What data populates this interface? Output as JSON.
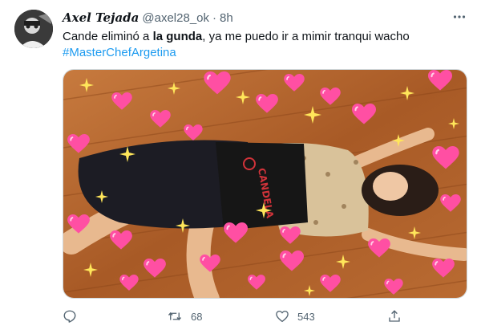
{
  "tweet": {
    "author": {
      "display_name": "Axel Tejada",
      "handle": "@axel28_ok",
      "separator": "·",
      "time": "8h"
    },
    "text_pre": "Cande eliminó a ",
    "text_bold": "la gunda",
    "text_post": ", ya me puedo ir a mimir tranqui wacho",
    "hashtag": "#MasterChefArgetina",
    "media": {
      "apron_text": "CANDELA",
      "decorations": [
        "pink-heart-icon",
        "sparkle-icon"
      ]
    },
    "actions": {
      "reply_icon": "reply-icon",
      "retweet_icon": "retweet-icon",
      "retweet_count": "68",
      "like_icon": "heart-icon",
      "like_count": "543",
      "share_icon": "share-icon"
    }
  },
  "colors": {
    "text": "#0f1419",
    "secondary": "#536471",
    "link": "#1d9bf0",
    "heart_pink": "#ff4fa3"
  }
}
